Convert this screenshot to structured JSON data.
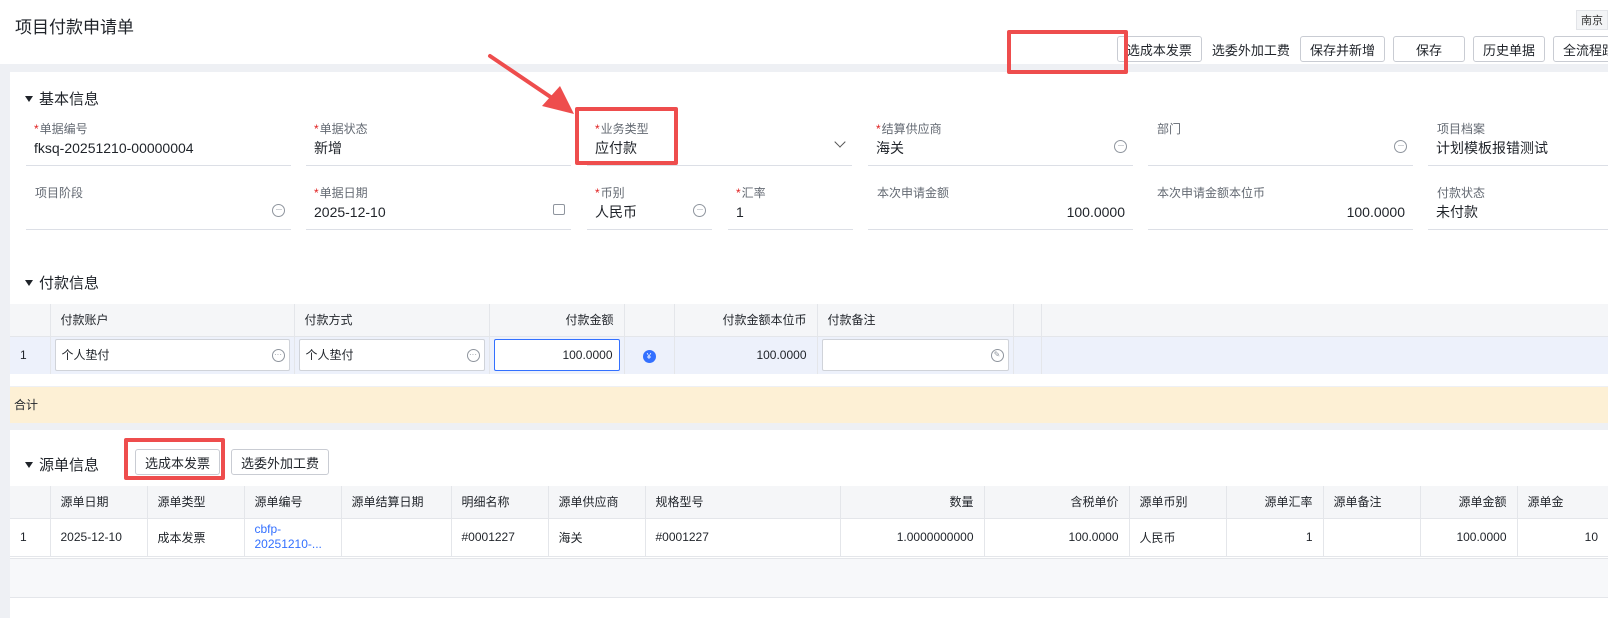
{
  "page": {
    "title": "项目付款申请单",
    "corner_tag": "南京"
  },
  "toolbar": {
    "buttons": [
      "选成本发票",
      "选委外加工费",
      "保存并新增",
      "保存",
      "历史单据",
      "全流程跟踪"
    ]
  },
  "basic": {
    "section_title": "基本信息",
    "fields": [
      {
        "label": "单据编号",
        "required": "*",
        "value": "fksq-20251210-00000004"
      },
      {
        "label": "单据状态",
        "required": "*",
        "value": "新增"
      },
      {
        "label": "业务类型",
        "required": "*",
        "value": "应付款"
      },
      {
        "label": "结算供应商",
        "required": "*",
        "value": "海关"
      },
      {
        "label": "部门",
        "required": "",
        "value": ""
      },
      {
        "label": "项目档案",
        "required": "",
        "value": "计划模板报错测试"
      },
      {
        "label": "项目阶段",
        "required": "",
        "value": ""
      },
      {
        "label": "单据日期",
        "required": "*",
        "value": "2025-12-10"
      },
      {
        "label": "币别",
        "required": "*",
        "value": "人民币"
      },
      {
        "label": "汇率",
        "required": "*",
        "value": "1"
      },
      {
        "label": "本次申请金额",
        "required": "",
        "value": "100.0000"
      },
      {
        "label": "本次申请金额本位币",
        "required": "",
        "value": "100.0000"
      },
      {
        "label": "付款状态",
        "required": "",
        "value": "未付款"
      }
    ]
  },
  "payment": {
    "section_title": "付款信息",
    "headers": [
      "付款账户",
      "付款方式",
      "付款金额",
      "付款金额本位币",
      "付款备注"
    ],
    "row": {
      "index": "1",
      "account": "个人垫付",
      "method": "个人垫付",
      "amount": "100.0000",
      "amount_base": "100.0000",
      "note": ""
    },
    "total_label": "合计"
  },
  "source": {
    "section_title": "源单信息",
    "buttons": [
      "选成本发票",
      "选委外加工费"
    ],
    "headers": [
      "源单日期",
      "源单类型",
      "源单编号",
      "源单结算日期",
      "明细名称",
      "源单供应商",
      "规格型号",
      "数量",
      "含税单价",
      "源单币别",
      "源单汇率",
      "源单备注",
      "源单金额",
      "源单金"
    ],
    "row": {
      "index": "1",
      "date": "2025-12-10",
      "type": "成本发票",
      "code_line1": "cbfp-",
      "code_line2": "20251210-...",
      "settle_date": "",
      "detail": "#0001227",
      "supplier": "海关",
      "spec": "#0001227",
      "qty": "1.0000000000",
      "unit_price": "100.0000",
      "currency": "人民币",
      "rate": "1",
      "note": "",
      "amount": "100.0000",
      "amount2": "10"
    }
  },
  "colors": {
    "accent": "#3370ff",
    "highlight": "#ee4d4d",
    "total_bg": "#fdf0d5"
  }
}
